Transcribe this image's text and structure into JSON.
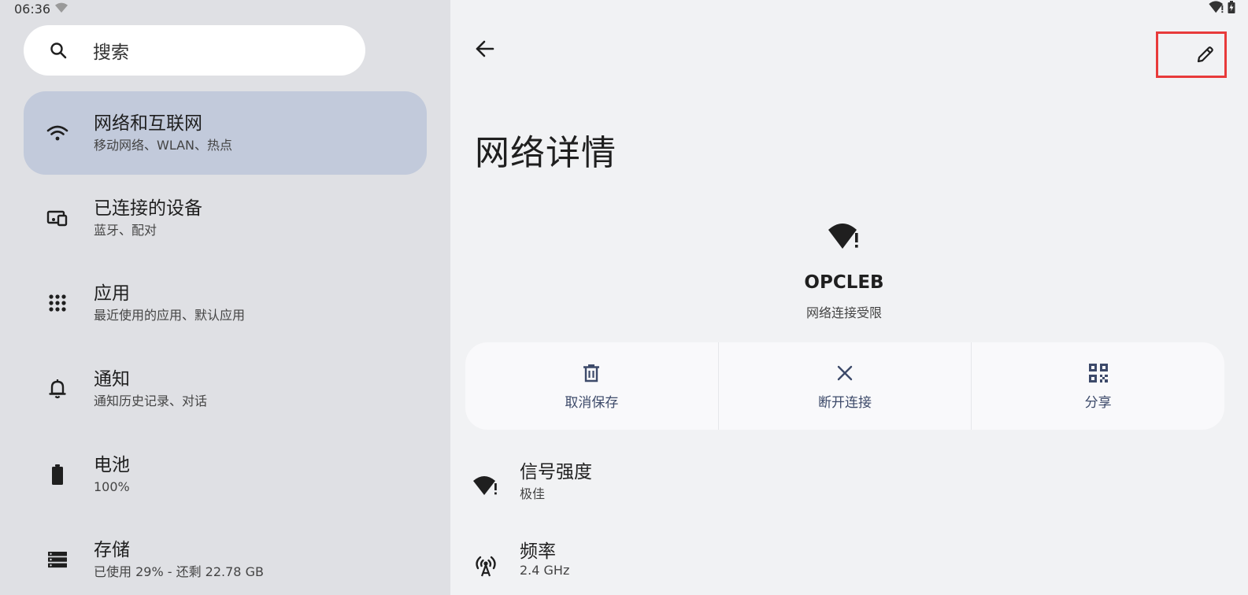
{
  "status_bar": {
    "time": "06:36",
    "left_icon": "wifi-limited-icon",
    "right_icons": [
      "wifi-limited-icon",
      "battery-charging-icon"
    ]
  },
  "search": {
    "icon": "search-icon",
    "label": "搜索"
  },
  "sidebar": {
    "items": [
      {
        "icon": "wifi-icon",
        "title": "网络和互联网",
        "subtitle": "移动网络、WLAN、热点",
        "active": true
      },
      {
        "icon": "connected-devices-icon",
        "title": "已连接的设备",
        "subtitle": "蓝牙、配对",
        "active": false
      },
      {
        "icon": "apps-grid-icon",
        "title": "应用",
        "subtitle": "最近使用的应用、默认应用",
        "active": false
      },
      {
        "icon": "bell-icon",
        "title": "通知",
        "subtitle": "通知历史记录、对话",
        "active": false
      },
      {
        "icon": "battery-icon",
        "title": "电池",
        "subtitle": "100%",
        "active": false
      },
      {
        "icon": "storage-icon",
        "title": "存储",
        "subtitle": "已使用 29% - 还剩 22.78 GB",
        "active": false
      }
    ]
  },
  "detail": {
    "back_icon": "arrow-back-icon",
    "edit_icon": "pencil-icon",
    "title": "网络详情",
    "network_icon": "wifi-limited-icon",
    "ssid": "OPCLEB",
    "status": "网络连接受限",
    "actions": [
      {
        "icon": "trash-icon",
        "label": "取消保存"
      },
      {
        "icon": "close-icon",
        "label": "断开连接"
      },
      {
        "icon": "qr-code-icon",
        "label": "分享"
      }
    ],
    "prefs": [
      {
        "icon": "wifi-limited-icon",
        "title": "信号强度",
        "subtitle": "极佳"
      },
      {
        "icon": "antenna-icon",
        "title": "频率",
        "subtitle": "2.4 GHz"
      }
    ]
  },
  "colors": {
    "sidebar_bg": "#dfe0e4",
    "active_item_bg": "#c2cadb",
    "content_bg": "#f1f2f4",
    "action_label": "#3d4a6a",
    "highlight_border": "#e83a3a"
  }
}
